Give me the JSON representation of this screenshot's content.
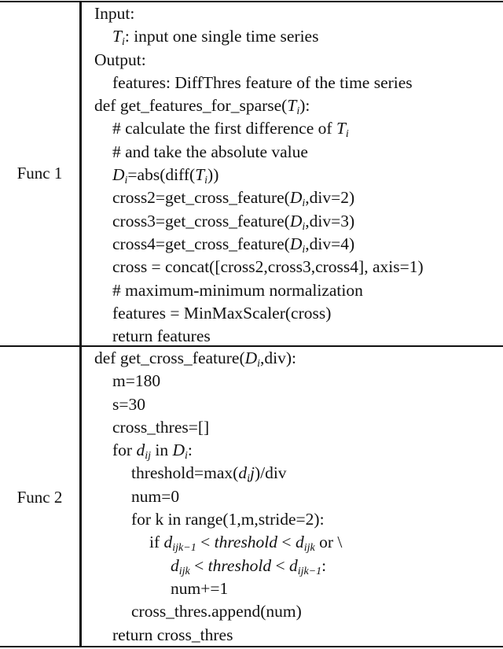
{
  "table": {
    "rows": [
      {
        "label": "Func 1",
        "lines": [
          {
            "indent": 0,
            "parts": [
              {
                "t": "Input:"
              }
            ]
          },
          {
            "indent": 1,
            "parts": [
              {
                "m": "T",
                "sub": "i"
              },
              {
                "t": ": input one single time series"
              }
            ]
          },
          {
            "indent": 0,
            "parts": [
              {
                "t": "Output:"
              }
            ]
          },
          {
            "indent": 1,
            "parts": [
              {
                "t": "features: DiffThres feature of the time series"
              }
            ]
          },
          {
            "indent": 0,
            "parts": [
              {
                "t": "def get_features_for_sparse("
              },
              {
                "m": "T",
                "sub": "i"
              },
              {
                "t": "):"
              }
            ]
          },
          {
            "indent": 1,
            "parts": [
              {
                "t": "# calculate the first difference of "
              },
              {
                "m": "T",
                "sub": "i"
              }
            ]
          },
          {
            "indent": 1,
            "parts": [
              {
                "t": "# and take the absolute value"
              }
            ]
          },
          {
            "indent": 1,
            "parts": [
              {
                "m": "D",
                "sub": "i"
              },
              {
                "t": "=abs(diff("
              },
              {
                "m": "T",
                "sub": "i"
              },
              {
                "t": "))"
              }
            ]
          },
          {
            "indent": 1,
            "parts": [
              {
                "t": "cross2=get_cross_feature("
              },
              {
                "m": "D",
                "sub": "i"
              },
              {
                "t": ",div=2)"
              }
            ]
          },
          {
            "indent": 1,
            "parts": [
              {
                "t": "cross3=get_cross_feature("
              },
              {
                "m": "D",
                "sub": "i"
              },
              {
                "t": ",div=3)"
              }
            ]
          },
          {
            "indent": 1,
            "parts": [
              {
                "t": "cross4=get_cross_feature("
              },
              {
                "m": "D",
                "sub": "i"
              },
              {
                "t": ",div=4)"
              }
            ]
          },
          {
            "indent": 1,
            "parts": [
              {
                "t": "cross = concat([cross2,cross3,cross4], axis=1)"
              }
            ]
          },
          {
            "indent": 1,
            "parts": [
              {
                "t": "# maximum-minimum normalization"
              }
            ]
          },
          {
            "indent": 1,
            "parts": [
              {
                "t": "features = MinMaxScaler(cross)"
              }
            ]
          },
          {
            "indent": 1,
            "parts": [
              {
                "t": "return features"
              }
            ]
          }
        ]
      },
      {
        "label": "Func 2",
        "lines": [
          {
            "indent": 0,
            "parts": [
              {
                "t": "def get_cross_feature("
              },
              {
                "m": "D",
                "sub": "i"
              },
              {
                "t": ",div):"
              }
            ]
          },
          {
            "indent": 1,
            "parts": [
              {
                "t": "m=180"
              }
            ]
          },
          {
            "indent": 1,
            "parts": [
              {
                "t": "s=30"
              }
            ]
          },
          {
            "indent": 1,
            "parts": [
              {
                "t": "cross_thres=[]"
              }
            ]
          },
          {
            "indent": 1,
            "parts": [
              {
                "t": "for "
              },
              {
                "m": "d",
                "sub": "ij"
              },
              {
                "t": " in "
              },
              {
                "m": "D",
                "sub": "i"
              },
              {
                "t": ":"
              }
            ]
          },
          {
            "indent": 2,
            "parts": [
              {
                "t": "threshold=max("
              },
              {
                "m": "d",
                "sub": "i"
              },
              {
                "m": "j"
              },
              {
                "t": ")/div"
              }
            ]
          },
          {
            "indent": 2,
            "parts": [
              {
                "t": "num=0"
              }
            ]
          },
          {
            "indent": 2,
            "parts": [
              {
                "t": "for k in range(1,m,stride=2):"
              }
            ]
          },
          {
            "indent": 3,
            "parts": [
              {
                "t": "if "
              },
              {
                "m": "d",
                "sub": "ijk−1"
              },
              {
                "t": " < "
              },
              {
                "m": "threshold"
              },
              {
                "t": " < "
              },
              {
                "m": "d",
                "sub": "ijk"
              },
              {
                "t": " or \\"
              }
            ]
          },
          {
            "indent": 4,
            "parts": [
              {
                "m": "d",
                "sub": "ijk"
              },
              {
                "t": " < "
              },
              {
                "m": "threshold"
              },
              {
                "t": " < "
              },
              {
                "m": "d",
                "sub": "ijk−1"
              },
              {
                "t": ":"
              }
            ]
          },
          {
            "indent": 4,
            "parts": [
              {
                "t": "num+=1"
              }
            ]
          },
          {
            "indent": 2,
            "parts": [
              {
                "t": "cross_thres.append(num)"
              }
            ]
          },
          {
            "indent": 1,
            "parts": [
              {
                "t": "return cross_thres"
              }
            ]
          }
        ]
      }
    ]
  }
}
